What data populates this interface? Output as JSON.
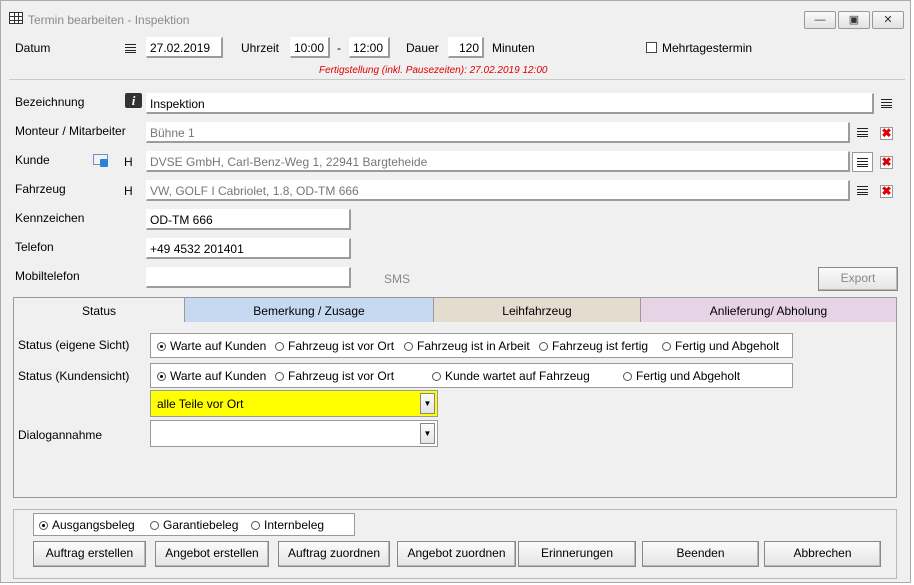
{
  "window": {
    "title": "Termin bearbeiten - Inspektion"
  },
  "header": {
    "datum_label": "Datum",
    "datum_value": "27.02.2019",
    "uhrzeit_label": "Uhrzeit",
    "time_from": "10:00",
    "time_sep": "-",
    "time_to": "12:00",
    "dauer_label": "Dauer",
    "dauer_value": "120",
    "minuten_label": "Minuten",
    "mehrtages_label": "Mehrtagestermin",
    "fertig_text": "Fertigstellung (inkl. Pausezeiten): 27.02.2019 12:00"
  },
  "form": {
    "bezeichnung_label": "Bezeichnung",
    "bezeichnung_value": "Inspektion",
    "monteur_label": "Monteur / Mitarbeiter",
    "monteur_value": "Bühne 1",
    "kunde_label": "Kunde",
    "kunde_h": "H",
    "kunde_value": "DVSE GmbH, Carl-Benz-Weg 1, 22941 Bargteheide",
    "fahrzeug_label": "Fahrzeug",
    "fahrzeug_h": "H",
    "fahrzeug_value": "VW, GOLF I Cabriolet, 1.8, OD-TM 666",
    "kennzeichen_label": "Kennzeichen",
    "kennzeichen_value": "OD-TM 666",
    "telefon_label": "Telefon",
    "telefon_value": "+49 4532 201401",
    "mobil_label": "Mobiltelefon",
    "mobil_value": "",
    "sms_label": "SMS",
    "export_label": "Export"
  },
  "tabs": [
    {
      "label": "Status",
      "color": "#f0f0f0"
    },
    {
      "label": "Bemerkung / Zusage",
      "color": "#c5daf0"
    },
    {
      "label": "Leihfahrzeug",
      "color": "#e3dccf"
    },
    {
      "label": "Anlieferung/ Abholung",
      "color": "#e6d3e6"
    }
  ],
  "status": {
    "eigene_label": "Status (eigene Sicht)",
    "eigene_options": [
      "Warte auf Kunden",
      "Fahrzeug ist vor Ort",
      "Fahrzeug ist in Arbeit",
      "Fahrzeug ist fertig",
      "Fertig und Abgeholt"
    ],
    "kunden_label": "Status (Kundensicht)",
    "kunden_options": [
      "Warte auf Kunden",
      "Fahrzeug ist vor Ort",
      "Kunde wartet auf Fahrzeug",
      "Fertig und Abgeholt"
    ],
    "teile_value": "alle Teile vor Ort",
    "teile_color": "#ffff00",
    "dialog_label": "Dialogannahme",
    "dialog_value": ""
  },
  "beleg": {
    "options": [
      "Ausgangsbeleg",
      "Garantiebeleg",
      "Internbeleg"
    ]
  },
  "buttons": {
    "auftrag_erstellen": "Auftrag erstellen",
    "angebot_erstellen": "Angebot erstellen",
    "auftrag_zuordnen": "Auftrag zuordnen",
    "angebot_zuordnen": "Angebot zuordnen",
    "erinnerungen": "Erinnerungen",
    "beenden": "Beenden",
    "abbrechen": "Abbrechen"
  }
}
